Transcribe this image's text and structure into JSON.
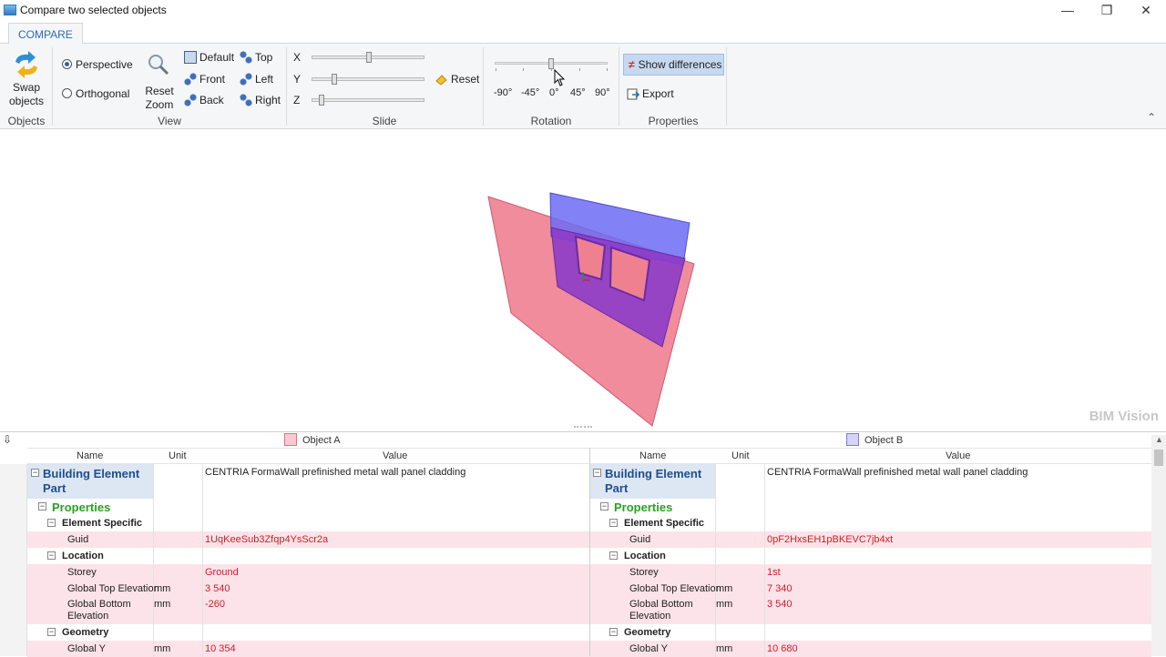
{
  "window": {
    "title": "Compare two selected objects",
    "minimize": "—",
    "restore": "❐",
    "close": "✕"
  },
  "ribbon": {
    "tab": "COMPARE",
    "objects": {
      "swap_label_1": "Swap",
      "swap_label_2": "objects",
      "group": "Objects"
    },
    "view": {
      "perspective": "Perspective",
      "orthogonal": "Orthogonal",
      "reset_zoom_1": "Reset",
      "reset_zoom_2": "Zoom",
      "default": "Default",
      "front": "Front",
      "back": "Back",
      "top": "Top",
      "left": "Left",
      "right": "Right",
      "group": "View",
      "projection": "perspective"
    },
    "slide": {
      "x": "X",
      "y": "Y",
      "z": "Z",
      "reset": "Reset",
      "group": "Slide",
      "x_level": 0.5,
      "y_level": 0.18,
      "z_level": 0.06
    },
    "rotation": {
      "ticks": [
        "-90°",
        "-45°",
        "0°",
        "45°",
        "90°"
      ],
      "group": "Rotation",
      "value_deg": 0
    },
    "properties": {
      "show_differences": "Show differences",
      "export": "Export",
      "group": "Properties"
    }
  },
  "viewport": {
    "watermark": "BIM Vision"
  },
  "compare": {
    "object_a": {
      "label": "Object A",
      "color": "#f08a98"
    },
    "object_b": {
      "label": "Object B",
      "color": "#a49ef0"
    },
    "columns": {
      "name": "Name",
      "unit": "Unit",
      "value": "Value"
    },
    "rows_a": [
      {
        "type": "category",
        "name": "Building Element Part",
        "value": "CENTRIA FormaWall prefinished metal wall panel cladding"
      },
      {
        "type": "section",
        "name": "Properties"
      },
      {
        "type": "group",
        "name": "Element Specific"
      },
      {
        "type": "prop",
        "name": "Guid",
        "unit": "",
        "value": "1UqKeeSub3Zfqp4YsScr2a",
        "diff": true
      },
      {
        "type": "group",
        "name": "Location"
      },
      {
        "type": "prop",
        "name": "Storey",
        "unit": "",
        "value": "Ground",
        "diff": true
      },
      {
        "type": "prop",
        "name": "Global Top Elevation",
        "unit": "mm",
        "value": "3 540",
        "diff": true
      },
      {
        "type": "prop2",
        "name1": "Global Bottom",
        "name2": "Elevation",
        "unit": "mm",
        "value": "-260",
        "diff": true
      },
      {
        "type": "group",
        "name": "Geometry"
      },
      {
        "type": "prop",
        "name": "Global Y",
        "unit": "mm",
        "value": "10 354",
        "diff": true
      }
    ],
    "rows_b": [
      {
        "type": "category",
        "name": "Building Element Part",
        "value": "CENTRIA FormaWall prefinished metal wall panel cladding"
      },
      {
        "type": "section",
        "name": "Properties"
      },
      {
        "type": "group",
        "name": "Element Specific"
      },
      {
        "type": "prop",
        "name": "Guid",
        "unit": "",
        "value": "0pF2HxsEH1pBKEVC7jb4xt",
        "diff": true
      },
      {
        "type": "group",
        "name": "Location"
      },
      {
        "type": "prop",
        "name": "Storey",
        "unit": "",
        "value": "1st",
        "diff": true
      },
      {
        "type": "prop",
        "name": "Global Top Elevation",
        "unit": "mm",
        "value": "7 340",
        "diff": true
      },
      {
        "type": "prop2",
        "name1": "Global Bottom",
        "name2": "Elevation",
        "unit": "mm",
        "value": "3 540",
        "diff": true
      },
      {
        "type": "group",
        "name": "Geometry"
      },
      {
        "type": "prop",
        "name": "Global Y",
        "unit": "mm",
        "value": "10 680",
        "diff": true
      }
    ]
  }
}
